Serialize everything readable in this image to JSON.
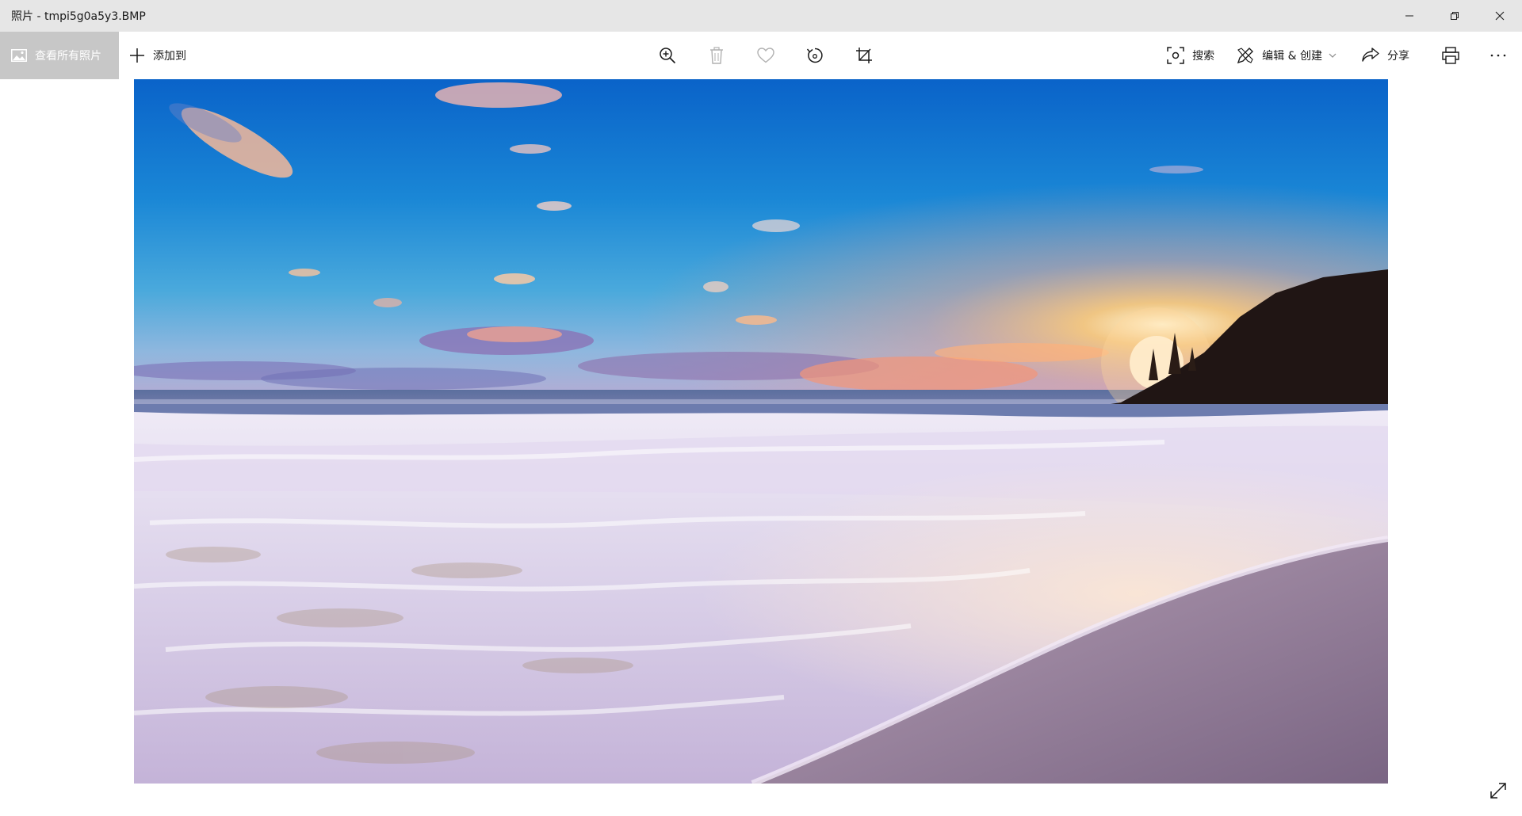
{
  "window": {
    "title": "照片 - tmpi5g0a5y3.BMP",
    "controls": [
      "minimize-icon",
      "restore-icon",
      "close-icon"
    ]
  },
  "toolbar": {
    "see_all_label": "查看所有照片",
    "add_to_label": "添加到",
    "center_tools": [
      "zoom-in-icon",
      "delete-icon",
      "favorite-icon",
      "rotate-icon",
      "crop-icon"
    ],
    "search_label": "搜索",
    "edit_create_label": "编辑 & 创建",
    "share_label": "分享",
    "print_icon": "print-icon",
    "more_icon": "more-icon"
  },
  "photo": {
    "description_icon": "beach-sunset-photo"
  },
  "colors": {
    "titlebar": "#e6e6e6",
    "see_all_bg": "#c7c7c7",
    "toolbar_bg": "#ffffff",
    "icon_dark": "#1a1a1a",
    "icon_disabled": "#b0b0b0"
  }
}
